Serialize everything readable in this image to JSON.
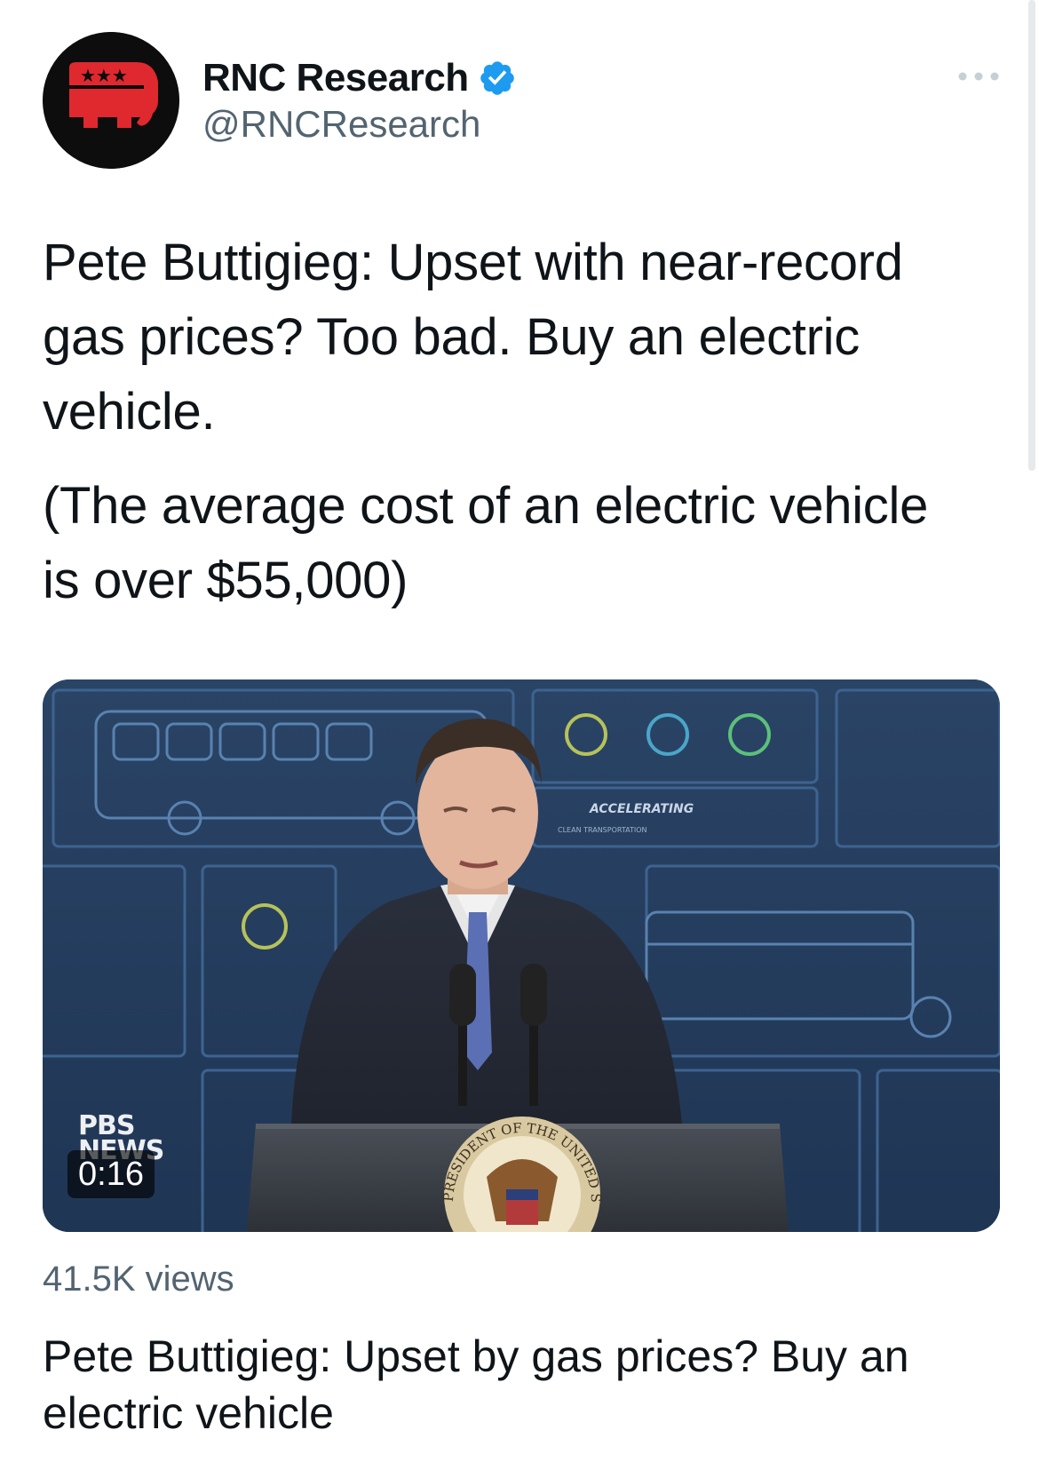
{
  "account": {
    "display_name": "RNC Research",
    "handle": "@RNCResearch",
    "avatar_icon": "republican-elephant-logo",
    "verified_icon": "verified-badge-icon",
    "verified_color": "#1d9bf0"
  },
  "menu": {
    "more_icon": "more-options-icon"
  },
  "tweet": {
    "paragraph_1": "Pete Buttigieg: Upset with near-record gas prices? Too bad. Buy an electric vehicle.",
    "paragraph_2": "(The average cost of an electric vehicle is over $55,000)"
  },
  "media": {
    "type": "video",
    "duration": "0:16",
    "pbs_line1": "PBS",
    "pbs_line2": "NEWS",
    "backdrop_text_1": "ACCELERATING",
    "backdrop_text_2": "CLEAN TRANSPORTATION",
    "seal_text": "PRESIDENT OF THE UNITED S"
  },
  "stats": {
    "views": "41.5K views"
  },
  "card": {
    "title": "Pete Buttigieg: Upset by gas prices? Buy an electric vehicle"
  },
  "colors": {
    "text_primary": "#0f1419",
    "text_secondary": "#536471",
    "backdrop_blue": "#233a5a",
    "logo_red": "#e0282f"
  }
}
